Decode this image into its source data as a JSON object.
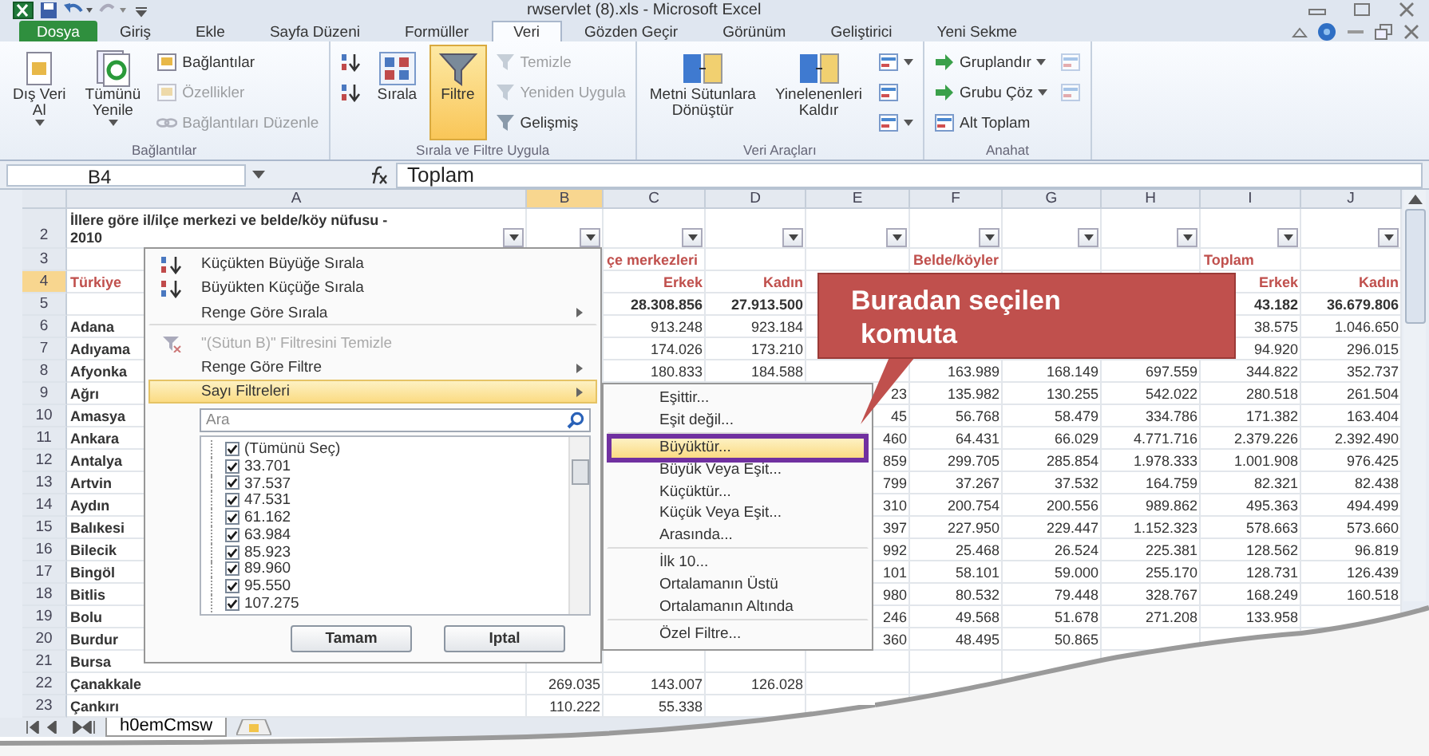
{
  "window": {
    "title": "rwservlet (8).xls - Microsoft Excel"
  },
  "tabs": [
    {
      "label": "Dosya",
      "kind": "file",
      "selected": false
    },
    {
      "label": "Giriş",
      "kind": "tab",
      "selected": false
    },
    {
      "label": "Ekle",
      "kind": "tab",
      "selected": false
    },
    {
      "label": "Sayfa Düzeni",
      "kind": "tab",
      "selected": false
    },
    {
      "label": "Formüller",
      "kind": "tab",
      "selected": false
    },
    {
      "label": "Veri",
      "kind": "tab",
      "selected": true
    },
    {
      "label": "Gözden Geçir",
      "kind": "tab",
      "selected": false
    },
    {
      "label": "Görünüm",
      "kind": "tab",
      "selected": false
    },
    {
      "label": "Geliştirici",
      "kind": "tab",
      "selected": false
    },
    {
      "label": "Yeni Sekme",
      "kind": "tab",
      "selected": false
    }
  ],
  "ribbon": {
    "groups": [
      {
        "label": "Bağlantılar",
        "items": [
          {
            "kind": "large",
            "lines": [
              "Dış Veri",
              "Al"
            ],
            "dropdown": true,
            "disabled": false
          },
          {
            "kind": "large",
            "lines": [
              "Tümünü",
              "Yenile"
            ],
            "dropdown": true,
            "disabled": false
          },
          {
            "kind": "small",
            "lines": [
              "Bağlantılar"
            ],
            "dropdown": false,
            "disabled": false
          },
          {
            "kind": "small",
            "lines": [
              "Özellikler"
            ],
            "dropdown": false,
            "disabled": true
          },
          {
            "kind": "small",
            "lines": [
              "Bağlantıları Düzenle"
            ],
            "dropdown": false,
            "disabled": true
          }
        ]
      },
      {
        "label": "Sırala ve Filtre Uygula",
        "items": [
          {
            "kind": "icon",
            "dropdown": false,
            "disabled": false,
            "on": false
          },
          {
            "kind": "icon",
            "dropdown": false,
            "disabled": false,
            "on": false
          },
          {
            "kind": "large",
            "lines": [
              "Sırala"
            ],
            "dropdown": false,
            "disabled": false,
            "on": false
          },
          {
            "kind": "large",
            "lines": [
              "Filtre"
            ],
            "dropdown": false,
            "disabled": false,
            "on": true
          },
          {
            "kind": "small",
            "lines": [
              "Temizle"
            ],
            "dropdown": false,
            "disabled": true,
            "on": false
          },
          {
            "kind": "small",
            "lines": [
              "Yeniden Uygula"
            ],
            "dropdown": false,
            "disabled": true,
            "on": false
          },
          {
            "kind": "small",
            "lines": [
              "Gelişmiş"
            ],
            "dropdown": false,
            "disabled": false,
            "on": false
          }
        ]
      },
      {
        "label": "Veri Araçları",
        "items": [
          {
            "kind": "large",
            "lines": [
              "Metni Sütunlara",
              "Dönüştür"
            ],
            "dropdown": false,
            "disabled": false
          },
          {
            "kind": "large",
            "lines": [
              "Yinelenenleri",
              "Kaldır"
            ],
            "dropdown": false,
            "disabled": false
          },
          {
            "kind": "icon",
            "dropdown": true,
            "disabled": false
          },
          {
            "kind": "icon",
            "dropdown": false,
            "disabled": false
          },
          {
            "kind": "icon",
            "dropdown": true,
            "disabled": false
          }
        ]
      },
      {
        "label": "Anahat",
        "items": [
          {
            "kind": "small",
            "lines": [
              "Gruplandır"
            ],
            "dropdown": true,
            "disabled": false
          },
          {
            "kind": "small",
            "lines": [
              "Grubu Çöz"
            ],
            "dropdown": true,
            "disabled": false
          },
          {
            "kind": "small",
            "lines": [
              "Alt Toplam"
            ],
            "dropdown": false,
            "disabled": false
          },
          {
            "kind": "icon",
            "dropdown": false,
            "disabled": true
          },
          {
            "kind": "icon",
            "dropdown": false,
            "disabled": true
          }
        ]
      }
    ]
  },
  "formula_bar": {
    "name_box": "B4",
    "formula": "Toplam"
  },
  "sheet": {
    "columns": [
      {
        "label": "A",
        "selected": false
      },
      {
        "label": "B",
        "selected": true
      },
      {
        "label": "C",
        "selected": false
      },
      {
        "label": "D",
        "selected": false
      },
      {
        "label": "E",
        "selected": false
      },
      {
        "label": "F",
        "selected": false
      },
      {
        "label": "G",
        "selected": false
      },
      {
        "label": "H",
        "selected": false
      },
      {
        "label": "I",
        "selected": false
      },
      {
        "label": "J",
        "selected": false
      }
    ],
    "rows": [
      {
        "number": "2",
        "kind": "title",
        "selected": false,
        "cells": [
          "İllere göre il/ilçe merkezi ve belde/köy nüfusu - 2010",
          null,
          null,
          null,
          null,
          null,
          null,
          null,
          null,
          null
        ]
      },
      {
        "number": "3",
        "kind": "group",
        "selected": false,
        "cells": [
          null,
          null,
          "çe merkezleri",
          null,
          null,
          "Belde/köyler",
          null,
          null,
          "Toplam",
          null
        ]
      },
      {
        "number": "4",
        "kind": "header",
        "selected": true,
        "cells": [
          "Türkiye",
          null,
          "Erkek",
          "Kadın",
          null,
          null,
          null,
          null,
          "Erkek",
          "Kadın"
        ]
      },
      {
        "number": "5",
        "kind": "total",
        "selected": false,
        "cells": [
          null,
          null,
          "28.308.856",
          "27.913.500",
          null,
          null,
          null,
          null,
          "43.182",
          "36.679.806"
        ]
      },
      {
        "number": "6",
        "kind": "data",
        "selected": false,
        "cells": [
          "Adana",
          null,
          "913.248",
          "923.184",
          null,
          null,
          null,
          null,
          "38.575",
          "1.046.650"
        ]
      },
      {
        "number": "7",
        "kind": "data",
        "selected": false,
        "cells": [
          "Adıyama",
          null,
          "174.026",
          "173.210",
          null,
          null,
          null,
          null,
          "94.920",
          "296.015"
        ]
      },
      {
        "number": "8",
        "kind": "data",
        "selected": false,
        "cells": [
          "Afyonka",
          null,
          "180.833",
          "184.588",
          null,
          "163.989",
          "168.149",
          "697.559",
          "344.822",
          "352.737"
        ]
      },
      {
        "number": "9",
        "kind": "data",
        "selected": false,
        "cells": [
          "Ağrı",
          null,
          null,
          null,
          "23",
          "135.982",
          "130.255",
          "542.022",
          "280.518",
          "261.504"
        ]
      },
      {
        "number": "10",
        "kind": "data",
        "selected": false,
        "cells": [
          "Amasya",
          null,
          null,
          null,
          "45",
          "56.768",
          "58.479",
          "334.786",
          "171.382",
          "163.404"
        ]
      },
      {
        "number": "11",
        "kind": "data",
        "selected": false,
        "cells": [
          "Ankara",
          null,
          null,
          null,
          "460",
          "64.431",
          "66.029",
          "4.771.716",
          "2.379.226",
          "2.392.490"
        ]
      },
      {
        "number": "12",
        "kind": "data",
        "selected": false,
        "cells": [
          "Antalya",
          null,
          null,
          null,
          "859",
          "299.705",
          "285.854",
          "1.978.333",
          "1.001.908",
          "976.425"
        ]
      },
      {
        "number": "13",
        "kind": "data",
        "selected": false,
        "cells": [
          "Artvin",
          null,
          null,
          null,
          "799",
          "37.267",
          "37.532",
          "164.759",
          "82.321",
          "82.438"
        ]
      },
      {
        "number": "14",
        "kind": "data",
        "selected": false,
        "cells": [
          "Aydın",
          null,
          null,
          null,
          "310",
          "200.754",
          "200.556",
          "989.862",
          "495.363",
          "494.499"
        ]
      },
      {
        "number": "15",
        "kind": "data",
        "selected": false,
        "cells": [
          "Balıkesi",
          null,
          null,
          null,
          "397",
          "227.950",
          "229.447",
          "1.152.323",
          "578.663",
          "573.660"
        ]
      },
      {
        "number": "16",
        "kind": "data",
        "selected": false,
        "cells": [
          "Bilecik",
          null,
          null,
          null,
          "992",
          "25.468",
          "26.524",
          "225.381",
          "128.562",
          "96.819"
        ]
      },
      {
        "number": "17",
        "kind": "data",
        "selected": false,
        "cells": [
          "Bingöl",
          null,
          null,
          null,
          "101",
          "58.101",
          "59.000",
          "255.170",
          "128.731",
          "126.439"
        ]
      },
      {
        "number": "18",
        "kind": "data",
        "selected": false,
        "cells": [
          "Bitlis",
          null,
          null,
          null,
          "980",
          "80.532",
          "79.448",
          "328.767",
          "168.249",
          "160.518"
        ]
      },
      {
        "number": "19",
        "kind": "data",
        "selected": false,
        "cells": [
          "Bolu",
          null,
          null,
          null,
          "246",
          "49.568",
          "51.678",
          "271.208",
          "133.958",
          null
        ]
      },
      {
        "number": "20",
        "kind": "data",
        "selected": false,
        "cells": [
          "Burdur",
          null,
          null,
          null,
          "360",
          "48.495",
          "50.865",
          null,
          null,
          null
        ]
      },
      {
        "number": "21",
        "kind": "data",
        "selected": false,
        "cells": [
          "Bursa",
          null,
          null,
          null,
          null,
          null,
          null,
          null,
          null,
          null
        ]
      },
      {
        "number": "22",
        "kind": "data",
        "selected": false,
        "cells": [
          "Çanakkale",
          "269.035",
          "143.007",
          "126.028",
          null,
          null,
          null,
          null,
          null,
          null
        ]
      },
      {
        "number": "23",
        "kind": "data",
        "selected": false,
        "cells": [
          "Çankırı",
          "110.222",
          "55.338",
          null,
          null,
          null,
          null,
          null,
          null,
          null
        ]
      }
    ]
  },
  "sheet_tabs": [
    {
      "label": "h0emCmsw",
      "selected": true
    }
  ],
  "filter_menu": {
    "items": [
      {
        "label": "Küçükten Büyüğe Sırala",
        "disabled": false,
        "selected": false,
        "submenu": false,
        "separator_after": false
      },
      {
        "label": "Büyükten Küçüğe Sırala",
        "disabled": false,
        "selected": false,
        "submenu": false,
        "separator_after": false
      },
      {
        "label": "Renge Göre Sırala",
        "disabled": false,
        "selected": false,
        "submenu": true,
        "separator_after": true
      },
      {
        "label": "\"(Sütun B)\" Filtresini Temizle",
        "disabled": true,
        "selected": false,
        "submenu": false,
        "separator_after": false
      },
      {
        "label": "Renge Göre Filtre",
        "disabled": false,
        "selected": false,
        "submenu": true,
        "separator_after": false
      },
      {
        "label": "Sayı Filtreleri",
        "disabled": false,
        "selected": true,
        "submenu": true,
        "separator_after": false
      }
    ],
    "search": {
      "placeholder": "Ara"
    },
    "values": [
      {
        "label": "(Tümünü Seç)",
        "checked": true
      },
      {
        "label": "33.701",
        "checked": true
      },
      {
        "label": "37.537",
        "checked": true
      },
      {
        "label": "47.531",
        "checked": true
      },
      {
        "label": "61.162",
        "checked": true
      },
      {
        "label": "63.984",
        "checked": true
      },
      {
        "label": "85.923",
        "checked": true
      },
      {
        "label": "89.960",
        "checked": true
      },
      {
        "label": "95.550",
        "checked": true
      },
      {
        "label": "107.275",
        "checked": true
      }
    ],
    "buttons": [
      "Tamam",
      "Iptal"
    ]
  },
  "number_filters_menu": {
    "items": [
      {
        "label": "Eşittir...",
        "selected": false,
        "separator_after": false
      },
      {
        "label": "Eşit değil...",
        "selected": false,
        "separator_after": true
      },
      {
        "label": "Büyüktür...",
        "selected": true,
        "separator_after": false
      },
      {
        "label": "Büyük Veya Eşit...",
        "selected": false,
        "separator_after": false
      },
      {
        "label": "Küçüktür...",
        "selected": false,
        "separator_after": false
      },
      {
        "label": "Küçük Veya Eşit...",
        "selected": false,
        "separator_after": false
      },
      {
        "label": "Arasında...",
        "selected": false,
        "separator_after": true
      },
      {
        "label": "İlk 10...",
        "selected": false,
        "separator_after": false
      },
      {
        "label": "Ortalamanın Üstü",
        "selected": false,
        "separator_after": false
      },
      {
        "label": "Ortalamanın Altında",
        "selected": false,
        "separator_after": true
      },
      {
        "label": "Özel Filtre...",
        "selected": false,
        "separator_after": false
      }
    ]
  },
  "callout": {
    "lines": [
      "Buradan seçilen",
      "komuta"
    ]
  }
}
